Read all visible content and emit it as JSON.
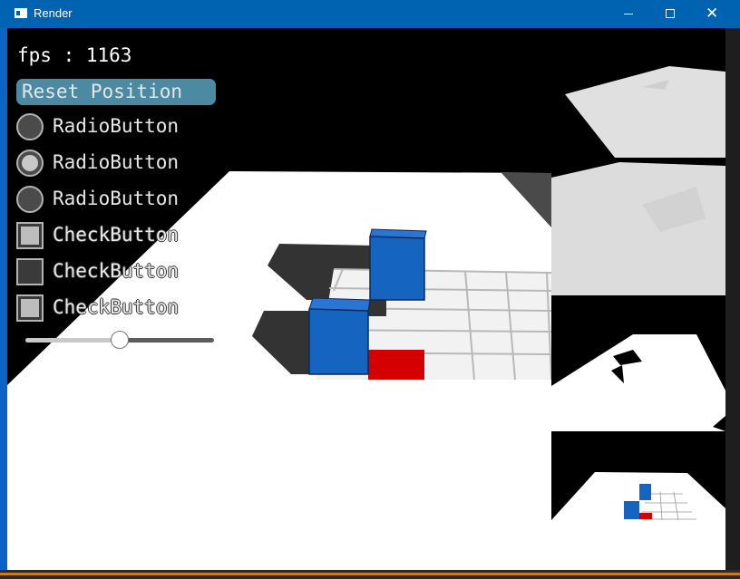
{
  "window": {
    "title": "Render",
    "minimize_label": "—",
    "maximize_label": "□",
    "close_label": "✕"
  },
  "hud": {
    "fps_text": "fps : 1163",
    "reset_button_label": "Reset Position",
    "radio_buttons": [
      {
        "label": "RadioButton",
        "selected": false
      },
      {
        "label": "RadioButton",
        "selected": true
      },
      {
        "label": "RadioButton",
        "selected": false
      }
    ],
    "check_buttons": [
      {
        "label": "CheckButton",
        "checked": true
      },
      {
        "label": "CheckButton",
        "checked": false
      },
      {
        "label": "CheckButton",
        "checked": true
      }
    ],
    "slider_value": 0.5
  },
  "scene": {
    "cube_color": "#1565c0",
    "marker_color": "#d40000",
    "background_color": "#000000",
    "floor_color": "#ffffff"
  }
}
